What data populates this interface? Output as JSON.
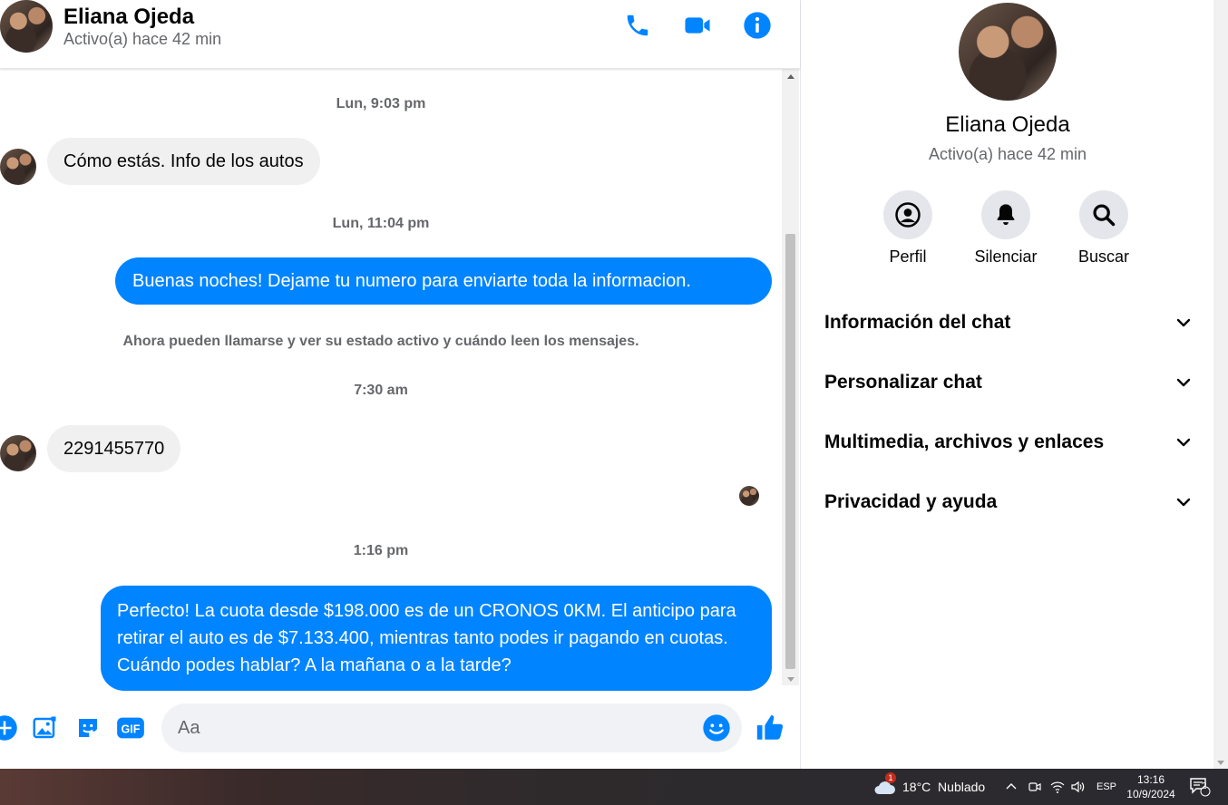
{
  "contact": {
    "name": "Eliana Ojeda",
    "status": "Activo(a) hace 42 min"
  },
  "header": {
    "call_icon": "phone-icon",
    "video_icon": "video-camera-icon",
    "info_icon": "info-icon"
  },
  "messages": [
    {
      "type": "timestamp",
      "text": "Lun, 9:03 pm"
    },
    {
      "type": "incoming",
      "text": "Cómo estás. Info de los autos"
    },
    {
      "type": "timestamp",
      "text": "Lun, 11:04 pm"
    },
    {
      "type": "outgoing",
      "text": "Buenas noches! Dejame tu numero para enviarte toda la informacion."
    },
    {
      "type": "system",
      "text": "Ahora pueden llamarse y ver su estado activo y cuándo leen los mensajes."
    },
    {
      "type": "timestamp",
      "text": "7:30 am"
    },
    {
      "type": "incoming",
      "text": "2291455770"
    },
    {
      "type": "timestamp",
      "text": "1:16 pm"
    },
    {
      "type": "outgoing",
      "text": "Perfecto! La cuota desde $198.000 es de un CRONOS 0KM. El anticipo para retirar el auto es de $7.133.400, mientras tanto podes ir pagando en cuotas. Cuándo podes hablar? A la mañana o a la tarde?"
    }
  ],
  "composer": {
    "placeholder": "Aa",
    "icons": [
      "plus-icon",
      "image-icon",
      "sticker-icon",
      "gif-icon",
      "emoji-icon",
      "thumbs-up-icon"
    ],
    "gif_label": "GIF"
  },
  "panel": {
    "name": "Eliana Ojeda",
    "status": "Activo(a) hace 42 min",
    "actions": [
      {
        "label": "Perfil",
        "icon": "profile-icon"
      },
      {
        "label": "Silenciar",
        "icon": "bell-icon"
      },
      {
        "label": "Buscar",
        "icon": "search-icon"
      }
    ],
    "sections": [
      "Información del chat",
      "Personalizar chat",
      "Multimedia, archivos y enlaces",
      "Privacidad y ayuda"
    ]
  },
  "taskbar": {
    "weather_badge": "1",
    "weather": "18°C  Nublado",
    "language": "ESP",
    "time": "13:16",
    "date": "10/9/2024",
    "notifications": "2"
  },
  "colors": {
    "accent": "#0084ff",
    "bubble_in": "#f0f0f0",
    "muted_text": "#65676b"
  }
}
